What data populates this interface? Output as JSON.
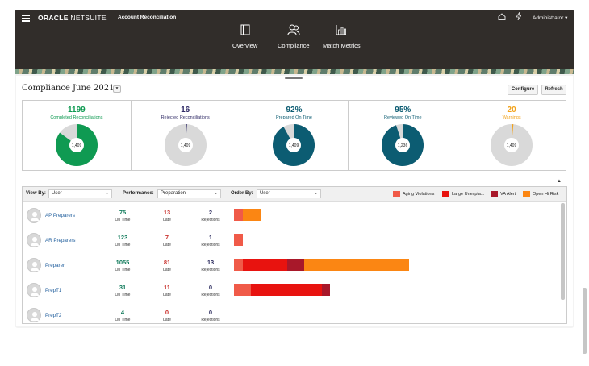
{
  "header": {
    "logo_brand": "ORACLE",
    "logo_product": "NETSUITE",
    "app_title": "Account Reconciliation",
    "user": "Administrator ▾",
    "nav": [
      {
        "label": "Overview",
        "icon": "book-icon"
      },
      {
        "label": "Compliance",
        "icon": "users-icon"
      },
      {
        "label": "Match Metrics",
        "icon": "bar-chart-icon"
      }
    ]
  },
  "page": {
    "title": "Compliance",
    "month": "June 2021",
    "configure_label": "Configure",
    "refresh_label": "Refresh"
  },
  "kpis": [
    {
      "value": "1199",
      "label": "Completed Reconciliations",
      "center": "1,409",
      "color": "#0f9a52",
      "fraction": 0.851
    },
    {
      "value": "16",
      "label": "Rejected Reconciliations",
      "center": "1,409",
      "color": "#302b66",
      "fraction": 0.011
    },
    {
      "value": "92%",
      "label": "Prepared On Time",
      "center": "1,409",
      "color": "#0c5c72",
      "fraction": 0.92
    },
    {
      "value": "95%",
      "label": "Reviewed On Time",
      "center": "1,236",
      "color": "#0c5c72",
      "fraction": 0.95
    },
    {
      "value": "20",
      "label": "Warnings",
      "center": "1,409",
      "color": "#f2a21b",
      "fraction": 0.014
    }
  ],
  "filters": {
    "view_by_label": "View By:",
    "view_by_value": "User",
    "performance_label": "Performance:",
    "performance_value": "Preparation",
    "order_by_label": "Order By:",
    "order_by_value": "User"
  },
  "legend": [
    {
      "label": "Aging Violations",
      "color": "#f05a48"
    },
    {
      "label": "Large Unexpla...",
      "color": "#e8130f"
    },
    {
      "label": "VA Alert",
      "color": "#a8182a"
    },
    {
      "label": "Open Hi Risk",
      "color": "#fb8613"
    }
  ],
  "stat_labels": {
    "on_time": "On Time",
    "late": "Late",
    "rejections": "Rejections"
  },
  "rows": [
    {
      "name": "AP Preparers",
      "on_time": "75",
      "late": "13",
      "rejections": "2",
      "segments": [
        4,
        0,
        0,
        9
      ]
    },
    {
      "name": "AR Preparers",
      "on_time": "123",
      "late": "7",
      "rejections": "1",
      "segments": [
        4,
        0,
        0,
        0
      ]
    },
    {
      "name": "Preparer",
      "on_time": "1055",
      "late": "81",
      "rejections": "13",
      "segments": [
        4,
        21,
        8,
        49
      ]
    },
    {
      "name": "PrepT1",
      "on_time": "31",
      "late": "11",
      "rejections": "0",
      "segments": [
        8,
        33,
        4,
        0
      ]
    },
    {
      "name": "PrepT2",
      "on_time": "4",
      "late": "0",
      "rejections": "0",
      "segments": [
        0,
        0,
        0,
        0
      ]
    }
  ],
  "colors": {
    "on_time": "#0f7a5a",
    "late": "#c9302c",
    "rejections": "#2b2b5e"
  }
}
